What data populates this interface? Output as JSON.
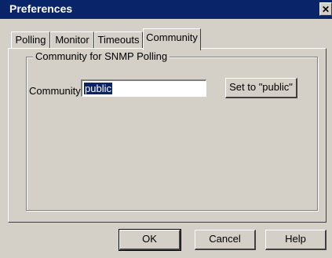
{
  "window": {
    "title": "Preferences",
    "close_glyph": "✕",
    "close_icon": "close-icon"
  },
  "tabs": [
    {
      "label": "Polling",
      "active": false
    },
    {
      "label": "Monitor",
      "active": false
    },
    {
      "label": "Timeouts",
      "active": false
    },
    {
      "label": "Community",
      "active": true
    }
  ],
  "group": {
    "label": "Community for SNMP Polling"
  },
  "community": {
    "label": "Community:",
    "value": "public",
    "set_public_label": "Set to \"public\""
  },
  "buttons": {
    "ok": "OK",
    "cancel": "Cancel",
    "help": "Help"
  },
  "colors": {
    "titlebar": "#0a246a",
    "face": "#d4d0c8",
    "selection": "#0a246a"
  }
}
